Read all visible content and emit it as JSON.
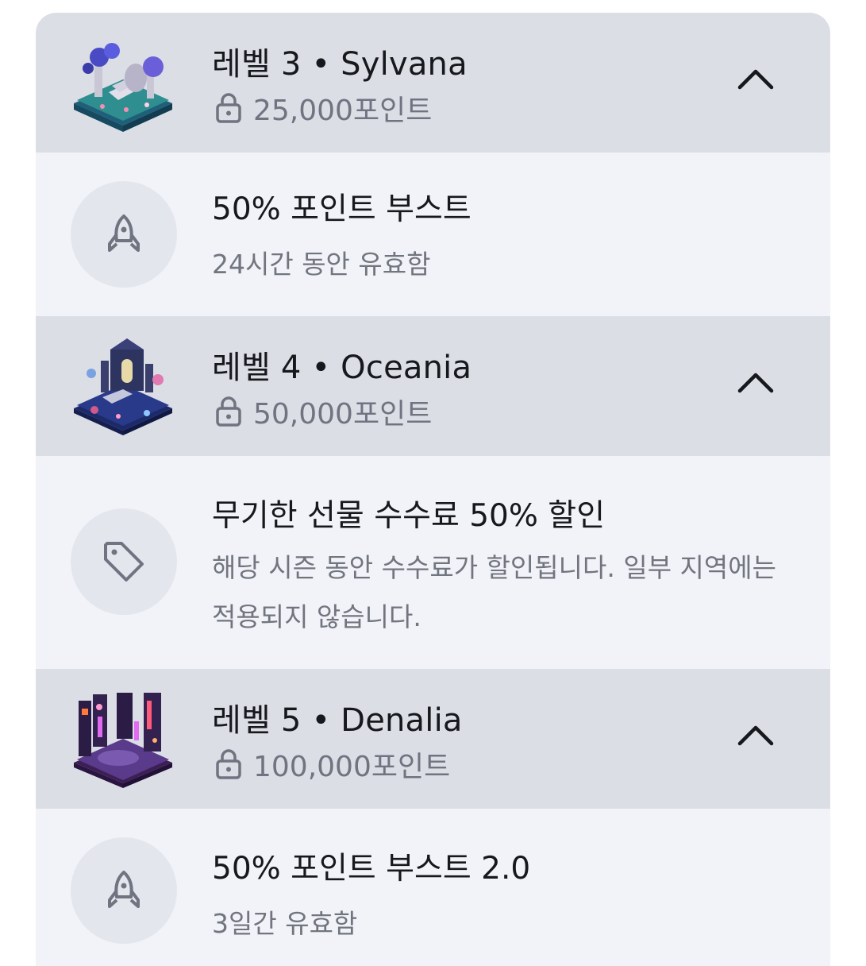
{
  "levels": [
    {
      "title": "레벨 3 • Sylvana",
      "points": "25,000포인트",
      "reward": {
        "icon": "rocket-icon",
        "title": "50% 포인트 부스트",
        "description": "24시간 동안 유효함"
      },
      "theme": "forest-ruins"
    },
    {
      "title": "레벨 4 • Oceania",
      "points": "50,000포인트",
      "reward": {
        "icon": "tag-icon",
        "title": "무기한 선물 수수료 50% 할인",
        "description": "해당 시즌 동안 수수료가 할인됩니다. 일부 지역에는 적용되지 않습니다."
      },
      "theme": "gothic-chapel"
    },
    {
      "title": "레벨 5 • Denalia",
      "points": "100,000포인트",
      "reward": {
        "icon": "rocket-icon",
        "title": "50% 포인트 부스트 2.0",
        "description": "3일간 유효함"
      },
      "theme": "neon-city"
    }
  ],
  "colors": {
    "header_bg": "#dcdee6",
    "body_bg": "#f2f3f8",
    "text_primary": "#17181c",
    "text_secondary": "#71757f"
  }
}
